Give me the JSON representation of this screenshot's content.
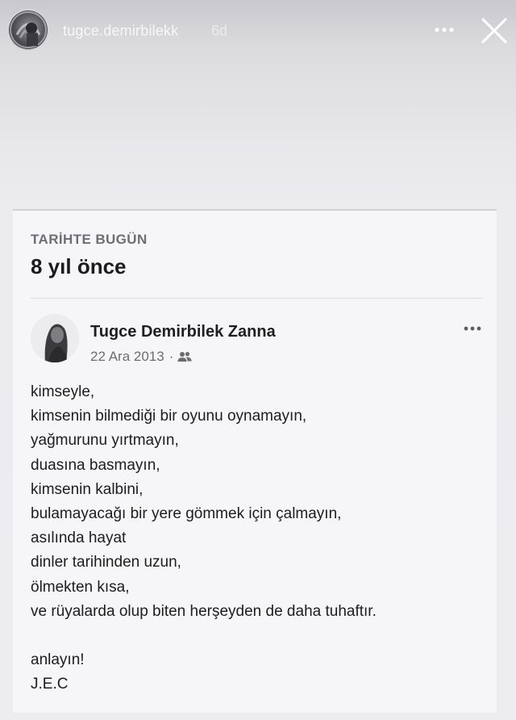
{
  "story": {
    "username": "tugce.demirbilekk",
    "time": "6d"
  },
  "memory": {
    "eyebrow": "TARİHTE BUGÜN",
    "title": "8 yıl önce"
  },
  "post": {
    "author": "Tugce Demirbilek Zanna",
    "date": "22 Ara 2013",
    "separator": "·",
    "lines": [
      "kimseyle,",
      "kimsenin bilmediği bir oyunu oynamayın,",
      "yağmurunu yırtmayın,",
      "duasına basmayın,",
      "kimsenin kalbini,",
      "bulamayacağı bir yere gömmek için çalmayın,",
      "asılında hayat",
      "dinler tarihinden uzun,",
      "ölmekten kısa,",
      "ve rüyalarda olup biten herşeyden de daha tuhaftır.",
      "",
      "anlayın!",
      "J.E.C"
    ]
  },
  "icons": {
    "story_avatar": "avatar-image",
    "more": "more-horizontal-icon",
    "close": "close-icon",
    "post_options": "more-horizontal-icon",
    "audience": "friends-icon"
  }
}
